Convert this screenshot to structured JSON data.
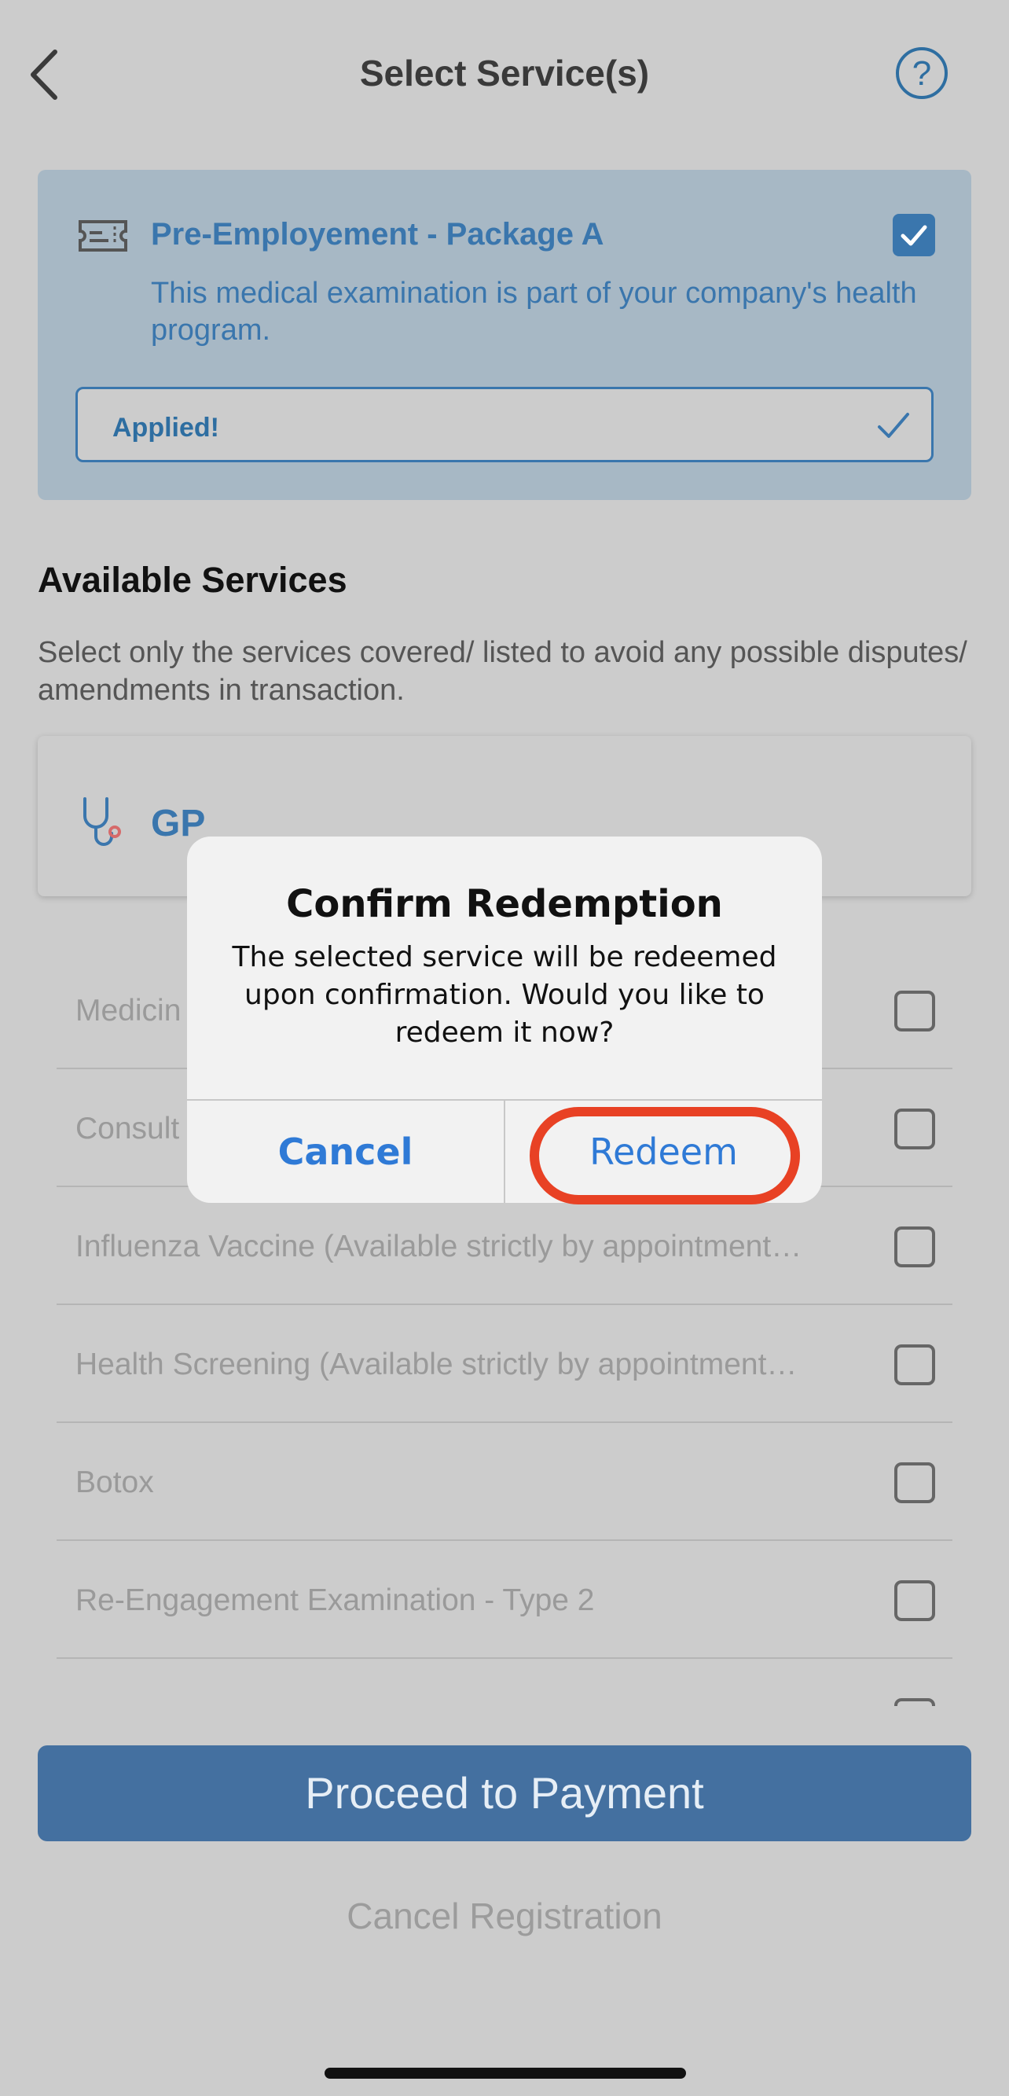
{
  "header": {
    "title": "Select Service(s)",
    "help_label": "?"
  },
  "package": {
    "name": "Pre-Employement - Package A",
    "description": "This medical examination is part of your company's health program.",
    "applied_label": "Applied!",
    "checked": true
  },
  "available_services": {
    "title": "Available Services",
    "description": "Select only the services covered/ listed to avoid any possible disputes/ amendments in transaction.",
    "category": "GP",
    "items": [
      {
        "label": "Medicin",
        "checked": false
      },
      {
        "label": "Consult",
        "checked": false
      },
      {
        "label": "Influenza Vaccine (Available strictly by appointment…",
        "checked": false
      },
      {
        "label": "Health Screening (Available strictly by appointment…",
        "checked": false
      },
      {
        "label": "Botox",
        "checked": false
      },
      {
        "label": "Re-Engagement Examination - Type 2",
        "checked": false
      },
      {
        "label": "",
        "checked": false
      }
    ]
  },
  "footer": {
    "proceed_label": "Proceed to Payment",
    "cancel_label": "Cancel Registration"
  },
  "dialog": {
    "title": "Confirm Redemption",
    "message": "The selected service will be redeemed upon confirmation. Would you like to redeem it now?",
    "cancel_label": "Cancel",
    "confirm_label": "Redeem"
  },
  "colors": {
    "accent": "#3a76ad",
    "button": "#4470a0",
    "dialog_link": "#2f7ad6",
    "highlight": "#e84124",
    "overlay_bg": "#cccccc"
  }
}
